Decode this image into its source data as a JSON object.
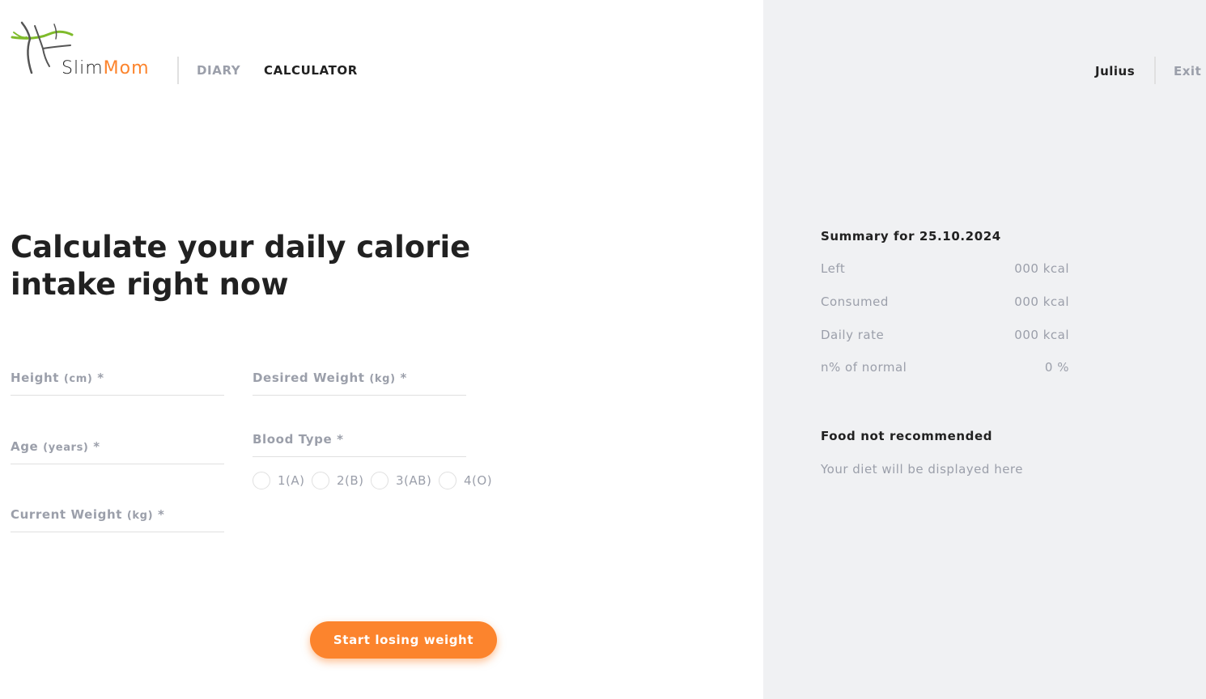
{
  "brand": {
    "name_part1": "Slim",
    "name_part2": "Mom",
    "accent_color": "#fc842d"
  },
  "nav": {
    "diary": "DIARY",
    "calculator": "CALCULATOR"
  },
  "user": {
    "name": "Julius",
    "exit": "Exit"
  },
  "main": {
    "title": "Calculate your daily calorie intake right now",
    "fields": {
      "height": {
        "label": "Height",
        "unit": "(cm)",
        "required": "*"
      },
      "desired_weight": {
        "label": "Desired Weight",
        "unit": "(kg)",
        "required": "*"
      },
      "age": {
        "label": "Age",
        "unit": "(years)",
        "required": "*"
      },
      "current_weight": {
        "label": "Current Weight",
        "unit": "(kg)",
        "required": "*"
      },
      "blood_type": {
        "label": "Blood Type",
        "required": "*"
      }
    },
    "blood_options": [
      "1(A)",
      "2(B)",
      "3(AB)",
      "4(O)"
    ],
    "submit": "Start losing weight"
  },
  "summary": {
    "title": "Summary for 25.10.2024",
    "rows": [
      {
        "label": "Left",
        "value": "000 kcal"
      },
      {
        "label": "Consumed",
        "value": "000 kcal"
      },
      {
        "label": "Daily rate",
        "value": "000 kcal"
      },
      {
        "label": "n% of normal",
        "value": "0 %"
      }
    ],
    "food_title": "Food not recommended",
    "food_text": "Your diet will be displayed here"
  }
}
